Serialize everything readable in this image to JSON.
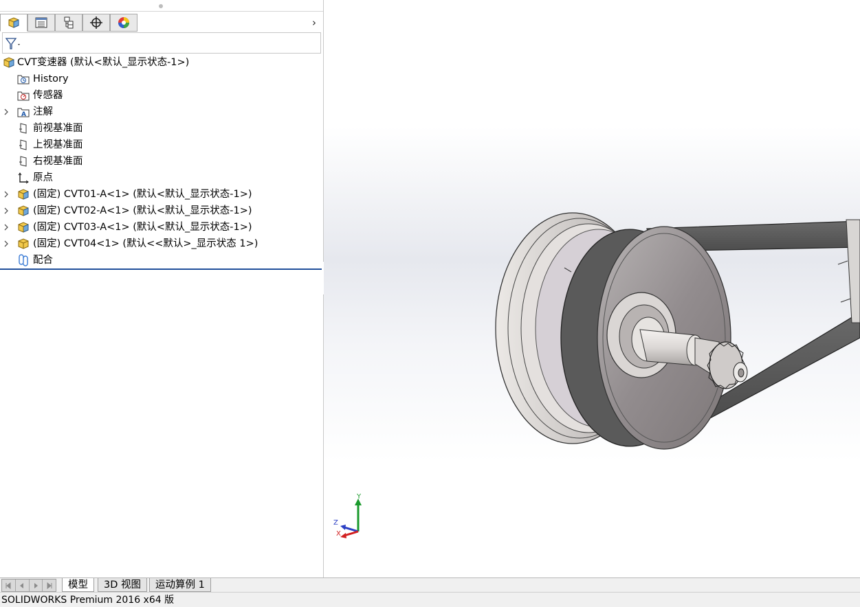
{
  "panel": {
    "tabs": [
      {
        "name": "feature-manager",
        "icon": "feature-manager-icon"
      },
      {
        "name": "property-manager",
        "icon": "property-manager-icon"
      },
      {
        "name": "configuration-manager",
        "icon": "configuration-manager-icon"
      },
      {
        "name": "dimxpert-manager",
        "icon": "dimxpert-icon"
      },
      {
        "name": "display-manager",
        "icon": "display-manager-icon"
      }
    ],
    "expand_arrow": "›"
  },
  "tree": {
    "root": "CVT变速器  (默认<默认_显示状态-1>)",
    "items": [
      {
        "label": "History",
        "icon": "history-folder-icon"
      },
      {
        "label": "传感器",
        "icon": "sensor-folder-icon"
      },
      {
        "label": "注解",
        "icon": "annotations-icon",
        "expandable": true
      },
      {
        "label": "前视基准面",
        "icon": "plane-icon"
      },
      {
        "label": "上视基准面",
        "icon": "plane-icon"
      },
      {
        "label": "右视基准面",
        "icon": "plane-icon"
      },
      {
        "label": "原点",
        "icon": "origin-icon"
      },
      {
        "label": "(固定) CVT01-A<1> (默认<默认_显示状态-1>)",
        "icon": "subassembly-icon",
        "expandable": true
      },
      {
        "label": "(固定) CVT02-A<1> (默认<默认_显示状态-1>)",
        "icon": "subassembly-icon",
        "expandable": true
      },
      {
        "label": "(固定) CVT03-A<1> (默认<默认_显示状态-1>)",
        "icon": "subassembly-icon",
        "expandable": true
      },
      {
        "label": "(固定) CVT04<1> (默认<<默认>_显示状态 1>)",
        "icon": "part-icon",
        "expandable": true
      },
      {
        "label": "配合",
        "icon": "mates-icon"
      }
    ]
  },
  "triad": {
    "x": "X",
    "y": "Y",
    "z": "Z"
  },
  "bottom_tabs": [
    "模型",
    "3D 视图",
    "运动算例 1"
  ],
  "status": "SOLIDWORKS Premium 2016 x64 版",
  "colors": {
    "accent": "#1f4e9a",
    "axis_x": "#d22020",
    "axis_y": "#1a9a2c",
    "axis_z": "#2b3fc4"
  }
}
